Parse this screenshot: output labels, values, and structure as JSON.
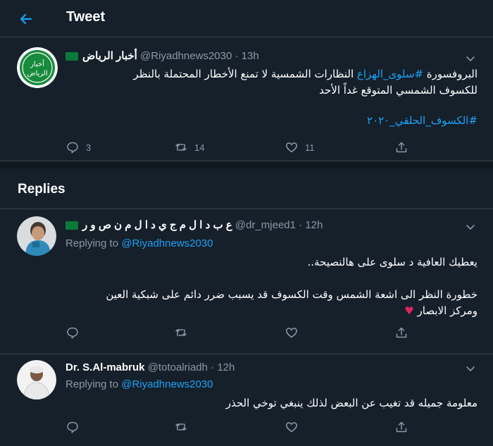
{
  "header": {
    "title": "Tweet"
  },
  "tweet": {
    "avatar_text_line1": "أخبار",
    "avatar_text_line2": "الرياض",
    "name": "أخبار الرياض",
    "handle": "@Riyadhnews2030",
    "time": "13h",
    "separator": "·",
    "text_prefix": "البروفسورة ",
    "hashtag_1": "#سلوى_الهزاع",
    "text_rest": " النظارات الشمسية لا تمنع الأخطار المحتملة بالنظر",
    "text_line2": "للكسوف الشمسي المتوقع غداً الأحد",
    "hashtag_2": "#الكسوف_الحلقي_٢٠٢٠",
    "replies_count": "3",
    "retweets_count": "14",
    "likes_count": "11"
  },
  "replies_section": {
    "title": "Replies"
  },
  "replies": [
    {
      "name": "ع ب د ا ل م ج ي د ا ل م ن ص و ر",
      "handle": "@dr_mjeed1",
      "time": "12h",
      "replying_label": "Replying to",
      "replying_to": "@Riyadhnews2030",
      "line1": "يعطيك العافية د سلوى على هالنصيحة..",
      "line2": "خطورة النظر الى اشعة الشمس وقت الكسوف قد يسبب ضرر دائم على شبكية العين",
      "line3": "ومركز الابصار",
      "emoji": "♥"
    },
    {
      "name": "Dr. S.Al-mabruk",
      "handle": "@totoalriadh",
      "time": "12h",
      "replying_label": "Replying to",
      "replying_to": "@Riyadhnews2030",
      "line1": "معلومة جميله قد تغيب عن البعض لذلك ينبغي توخي الحذر"
    }
  ],
  "colors": {
    "background": "#15202b",
    "accent": "#1da1f2",
    "muted": "#8899a6",
    "border": "#38444d"
  },
  "icons": [
    "back-arrow-icon",
    "chevron-down-icon",
    "reply-icon",
    "retweet-icon",
    "like-icon",
    "share-icon",
    "flag-icon"
  ]
}
